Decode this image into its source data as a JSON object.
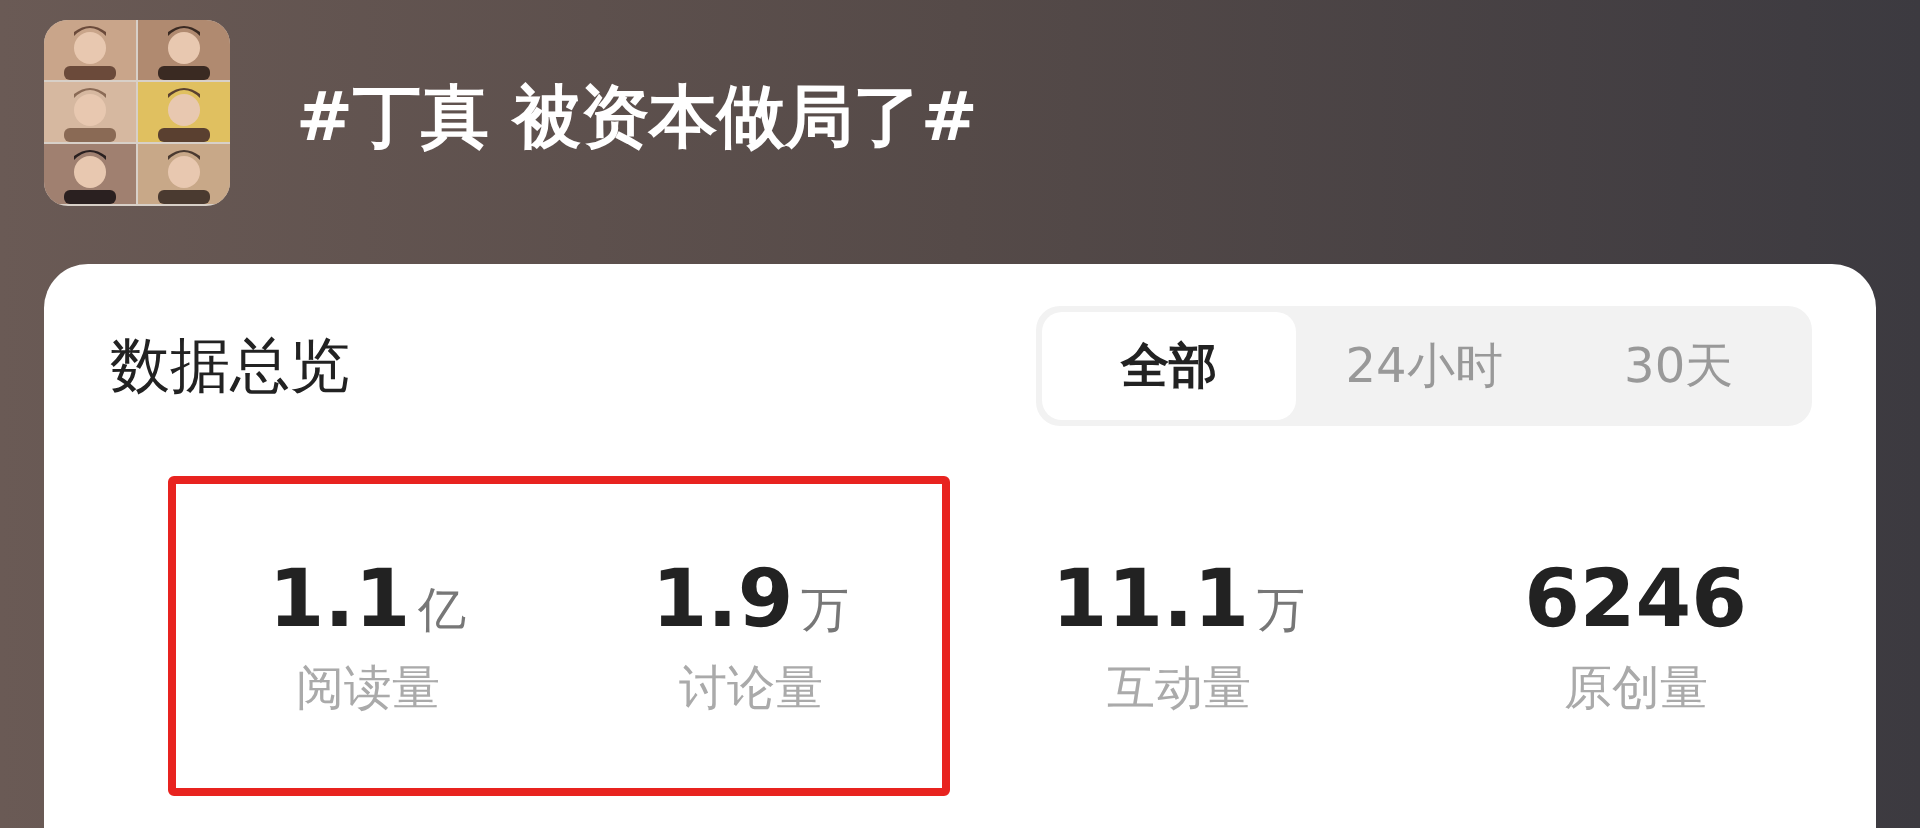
{
  "topic": {
    "title": "#丁真 被资本做局了#"
  },
  "overview": {
    "title": "数据总览",
    "tabs": [
      {
        "label": "全部",
        "selected": true
      },
      {
        "label": "24小时",
        "selected": false
      },
      {
        "label": "30天",
        "selected": false
      }
    ],
    "stats": [
      {
        "value": "1.1",
        "unit": "亿",
        "label": "阅读量",
        "highlighted": true
      },
      {
        "value": "1.9",
        "unit": "万",
        "label": "讨论量",
        "highlighted": true
      },
      {
        "value": "11.1",
        "unit": "万",
        "label": "互动量",
        "highlighted": false
      },
      {
        "value": "6246",
        "label": "原创量",
        "highlighted": false
      }
    ]
  }
}
